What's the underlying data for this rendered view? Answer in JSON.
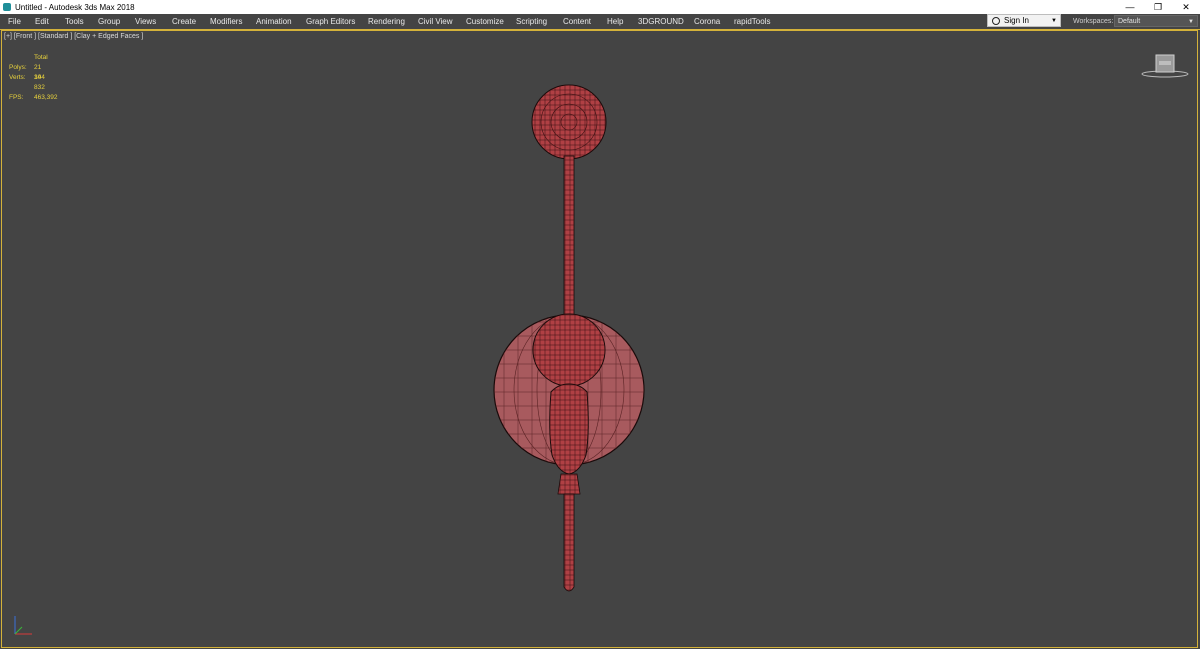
{
  "window": {
    "title": "Untitled - Autodesk 3ds Max 2018",
    "controls": [
      "—",
      "❐",
      "✕"
    ]
  },
  "menu": {
    "items": [
      "File",
      "Edit",
      "Tools",
      "Group",
      "Views",
      "Create",
      "Modifiers",
      "Animation",
      "Graph Editors",
      "Rendering",
      "Civil View",
      "Customize",
      "Scripting",
      "Content",
      "Help",
      "3DGROUND",
      "Corona",
      "rapidTools"
    ]
  },
  "account": {
    "sign_in": "Sign In"
  },
  "workspaces": {
    "label": "Workspaces:",
    "value": "Default"
  },
  "viewport": {
    "label": "[+] [Front ] [Standard ] [Clay + Edged Faces ]",
    "stats": {
      "header": "Total",
      "polys_label": "Polys:",
      "polys_value": "21 344",
      "verts_label": "Verts:",
      "verts_value": "10 832",
      "fps_label": "FPS:",
      "fps_value": "463,392"
    }
  },
  "colors": {
    "mesh": "#b04044",
    "wire": "#3a1012",
    "accent": "#d4b23a",
    "stats": "#e8d23c"
  }
}
